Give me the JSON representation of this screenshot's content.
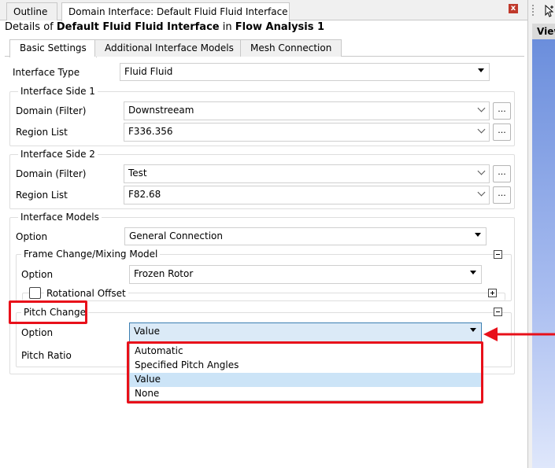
{
  "tabs": [
    {
      "label": "Outline"
    },
    {
      "label": "Domain Interface: Default Fluid Fluid Interface"
    }
  ],
  "close_icon_glyph": "x",
  "viewer": {
    "header_label": "View"
  },
  "details": {
    "prefix": "Details of ",
    "object_name": "Default Fluid Fluid Interface",
    "middle": " in ",
    "analysis_name": "Flow Analysis 1"
  },
  "subtabs": [
    {
      "label": "Basic Settings"
    },
    {
      "label": "Additional Interface Models"
    },
    {
      "label": "Mesh Connection"
    }
  ],
  "interface_type": {
    "label": "Interface Type",
    "value": "Fluid Fluid"
  },
  "side1": {
    "title": "Interface Side 1",
    "domain_label": "Domain (Filter)",
    "domain_value": "Downstreeam",
    "region_label": "Region List",
    "region_value": "F336.356",
    "browse_label": "..."
  },
  "side2": {
    "title": "Interface Side 2",
    "domain_label": "Domain (Filter)",
    "domain_value": "Test",
    "region_label": "Region List",
    "region_value": "F82.68",
    "browse_label": "..."
  },
  "interface_models": {
    "title": "Interface Models",
    "option_label": "Option",
    "option_value": "General Connection"
  },
  "frame_change": {
    "title": "Frame Change/Mixing Model",
    "option_label": "Option",
    "option_value": "Frozen Rotor",
    "rotational_offset_label": "Rotational Offset"
  },
  "pitch_change": {
    "title": "Pitch Change",
    "option_label": "Option",
    "option_value": "Value",
    "pitch_ratio_label": "Pitch Ratio",
    "dropdown_options": [
      "Automatic",
      "Specified Pitch Angles",
      "Value",
      "None"
    ],
    "selected_index": 2
  },
  "colors": {
    "highlight_red": "#e8101a",
    "selection_blue": "#cce4f7",
    "viewer_blue": "#6b8edc"
  }
}
